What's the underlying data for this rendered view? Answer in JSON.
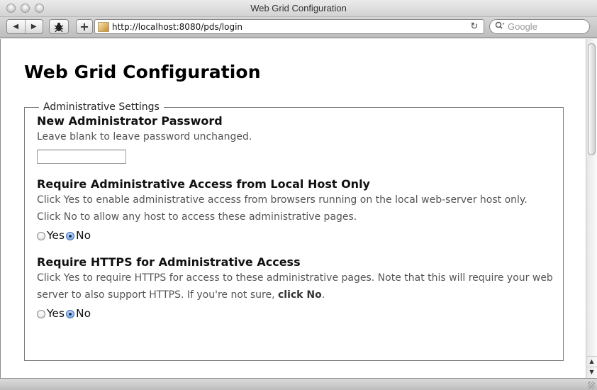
{
  "window": {
    "title": "Web Grid Configuration"
  },
  "toolbar": {
    "back_glyph": "◀",
    "forward_glyph": "▶",
    "add_glyph": "+",
    "url": "http://localhost:8080/pds/login",
    "reload_glyph": "↻",
    "search_placeholder": "Google"
  },
  "page": {
    "title": "Web Grid Configuration",
    "fieldset_legend": "Administrative Settings",
    "sections": {
      "password": {
        "title": "New Administrator Password",
        "description": "Leave blank to leave password unchanged.",
        "value": ""
      },
      "local_host": {
        "title": "Require Administrative Access from Local Host Only",
        "description_line1": "Click Yes to enable administrative access from browsers running on the local web-server host only.",
        "description_line2": "Click No to allow any host to access these administrative pages.",
        "yes_label": "Yes",
        "no_label": "No",
        "selected": "No"
      },
      "https": {
        "title": "Require HTTPS for Administrative Access",
        "description_line1": "Click Yes to require HTTPS for access to these administrative pages. Note that this will require your web",
        "description_line2_prefix": "server to also support HTTPS. If you're not sure, ",
        "description_line2_bold": "click No",
        "description_line2_suffix": ".",
        "yes_label": "Yes",
        "no_label": "No",
        "selected": "No"
      }
    }
  }
}
